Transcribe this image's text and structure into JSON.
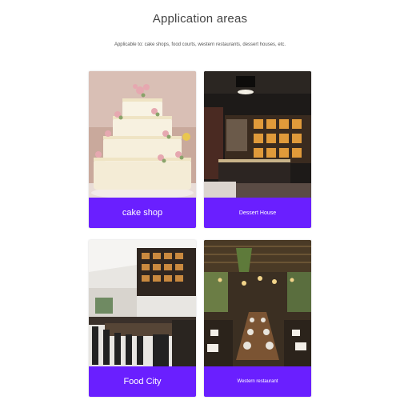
{
  "header": {
    "title": "Application areas",
    "subtitle": "Applicable to: cake shops, food courts, western restaurants, dessert houses, etc."
  },
  "cards": [
    {
      "label": "cake shop",
      "image": "wedding-cake-photo"
    },
    {
      "label": "Dessert House",
      "image": "dessert-shop-interior-photo"
    },
    {
      "label": "Food City",
      "image": "food-court-bar-photo"
    },
    {
      "label": "Western restaurant",
      "image": "western-restaurant-interior-photo"
    }
  ],
  "colors": {
    "label_background": "#6a1fff",
    "label_text": "#ffffff",
    "title_text": "#444444"
  }
}
